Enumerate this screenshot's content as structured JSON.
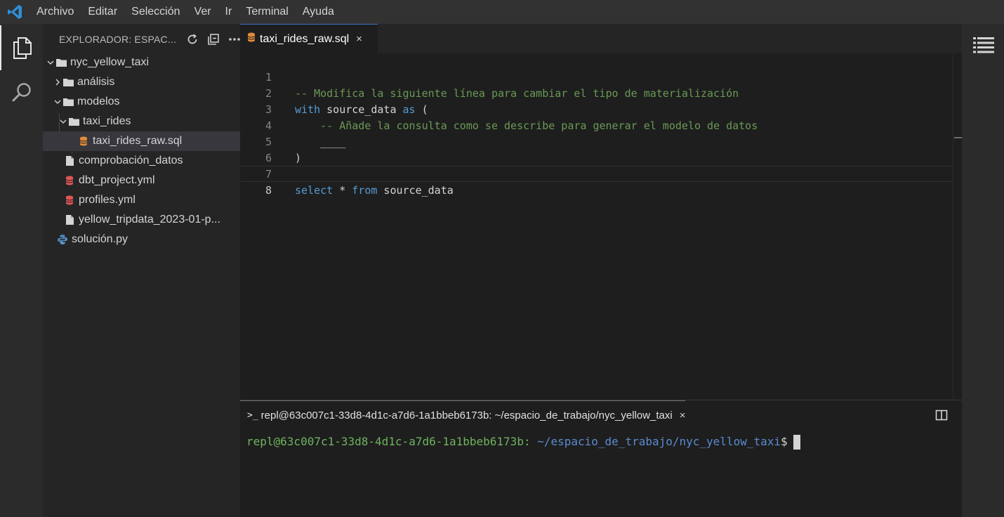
{
  "colors": {
    "accent": "#3c6fbf",
    "comment": "#6a9955",
    "keyword": "#569cd6",
    "terminal_user": "#6fb35f",
    "terminal_path": "#5a8bd1"
  },
  "menubar": {
    "items": [
      "Archivo",
      "Editar",
      "Selección",
      "Ver",
      "Ir",
      "Terminal",
      "Ayuda"
    ]
  },
  "activitybar": {
    "icons": [
      "explorer-icon",
      "search-icon"
    ]
  },
  "sidebar": {
    "title": "EXPLORADOR: ESPAC...",
    "actions": [
      "refresh-icon",
      "collapse-all-icon",
      "more-icon"
    ],
    "tree": [
      {
        "label": "nyc_yellow_taxi",
        "type": "folder",
        "expanded": true
      },
      {
        "label": "análisis",
        "type": "folder",
        "expanded": false
      },
      {
        "label": "modelos",
        "type": "folder",
        "expanded": true
      },
      {
        "label": "taxi_rides",
        "type": "folder",
        "expanded": true
      },
      {
        "label": "taxi_rides_raw.sql",
        "type": "sql-file",
        "selected": true
      },
      {
        "label": "comprobación_datos",
        "type": "file"
      },
      {
        "label": "dbt_project.yml",
        "type": "yml-file"
      },
      {
        "label": "profiles.yml",
        "type": "yml-file"
      },
      {
        "label": "yellow_tripdata_2023-01-p...",
        "type": "file"
      },
      {
        "label": "solución.py",
        "type": "python-file"
      }
    ]
  },
  "editor": {
    "tab": {
      "label": "taxi_rides_raw.sql",
      "close": "×"
    },
    "current_line": 8,
    "lines": [
      {
        "n": "1",
        "segments": [
          {
            "t": "-- Modifica la siguiente línea para cambiar el tipo de materialización",
            "c": "cmt"
          }
        ]
      },
      {
        "n": "2",
        "segments": [
          {
            "t": "with",
            "c": "kw"
          },
          {
            "t": " source_data ",
            "c": "id"
          },
          {
            "t": "as",
            "c": "kw"
          },
          {
            "t": " (",
            "c": "id"
          }
        ]
      },
      {
        "n": "3",
        "segments": [
          {
            "t": "    -- Añade la consulta como se describe para generar el modelo de datos",
            "c": "cmt"
          }
        ]
      },
      {
        "n": "4",
        "segments": [
          {
            "t": "    ____",
            "c": "id"
          }
        ]
      },
      {
        "n": "5",
        "segments": [
          {
            "t": ")",
            "c": "id"
          }
        ]
      },
      {
        "n": "6",
        "segments": []
      },
      {
        "n": "7",
        "segments": [
          {
            "t": "select",
            "c": "kw"
          },
          {
            "t": " * ",
            "c": "id"
          },
          {
            "t": "from",
            "c": "kw"
          },
          {
            "t": " source_data",
            "c": "id"
          }
        ]
      },
      {
        "n": "8",
        "segments": []
      }
    ]
  },
  "panel": {
    "tab_prompt": ">_",
    "tab_label": "repl@63c007c1-33d8-4d1c-a7d6-1a1bbeb6173b: ~/espacio_de_trabajo/nyc_yellow_taxi",
    "tab_close": "×",
    "terminal": {
      "user": "repl@63c007c1-33d8-4d1c-a7d6-1a1bbeb6173b:",
      "path": " ~/espacio_de_trabajo/nyc_yellow_taxi",
      "dollar": "$"
    }
  }
}
